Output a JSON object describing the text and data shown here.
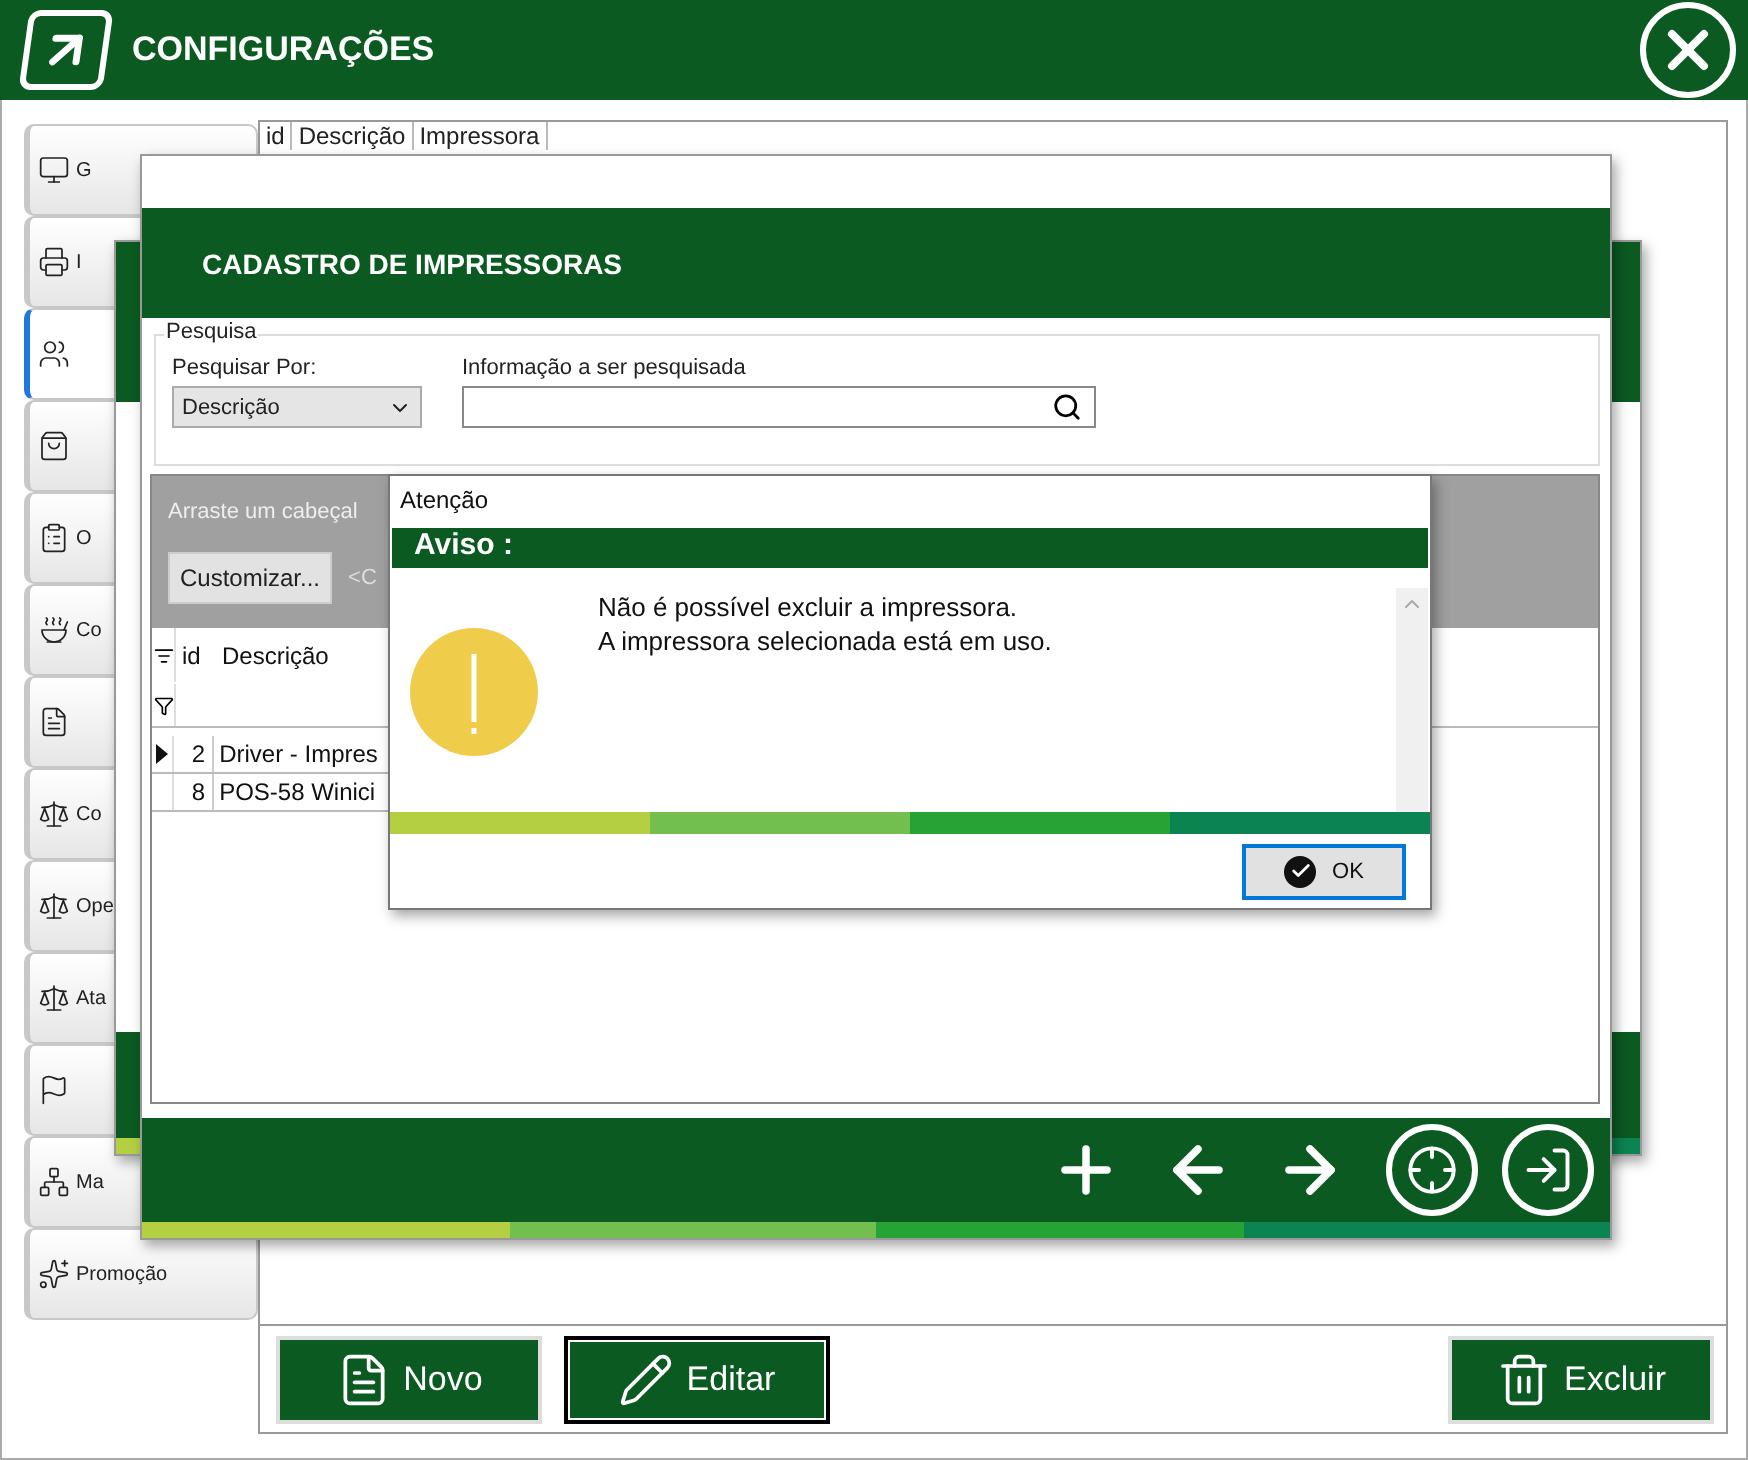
{
  "window": {
    "title": "CONFIGURAÇÕES"
  },
  "sidebar": {
    "items": [
      {
        "label": "G",
        "selected": false
      },
      {
        "label": "I",
        "selected": false
      },
      {
        "selected": true
      },
      {
        "selected": false
      },
      {
        "label": "O",
        "selected": false
      },
      {
        "label": "Co",
        "selected": false
      },
      {
        "selected": false
      },
      {
        "label": "Co",
        "selected": false
      },
      {
        "label": "Ope",
        "selected": false
      },
      {
        "label": "Ata",
        "selected": false
      },
      {
        "selected": false
      },
      {
        "label": "Ma",
        "selected": false
      },
      {
        "label": "Promoção",
        "selected": false
      }
    ]
  },
  "main_table": {
    "columns": [
      "id",
      "Descrição",
      "Impressora"
    ]
  },
  "actions": [
    {
      "label": "Novo",
      "focused": false
    },
    {
      "label": "Editar",
      "focused": true
    },
    {
      "label": "Excluir",
      "focused": false
    }
  ],
  "printer_window": {
    "title": "CADASTRO DE IMPRESSORAS",
    "search": {
      "group_label": "Pesquisa",
      "by_label": "Pesquisar Por:",
      "by_value": "Descrição",
      "info_label": "Informação a ser pesquisada"
    },
    "grid": {
      "group_hint": "Arraste um cabeçal",
      "customize_button": "Customizar...",
      "column_hint": "<C",
      "columns": [
        "id",
        "Descrição"
      ],
      "rows": [
        {
          "id": "2",
          "description": "Driver - Impres",
          "selected": true
        },
        {
          "id": "8",
          "description": "POS-58 Winici",
          "selected": false
        }
      ]
    }
  },
  "alert": {
    "title": "Atenção",
    "heading": "Aviso :",
    "lines": [
      "Não é possível excluir a impressora.",
      "A impressora selecionada está em uso."
    ],
    "ok_button": "OK"
  }
}
